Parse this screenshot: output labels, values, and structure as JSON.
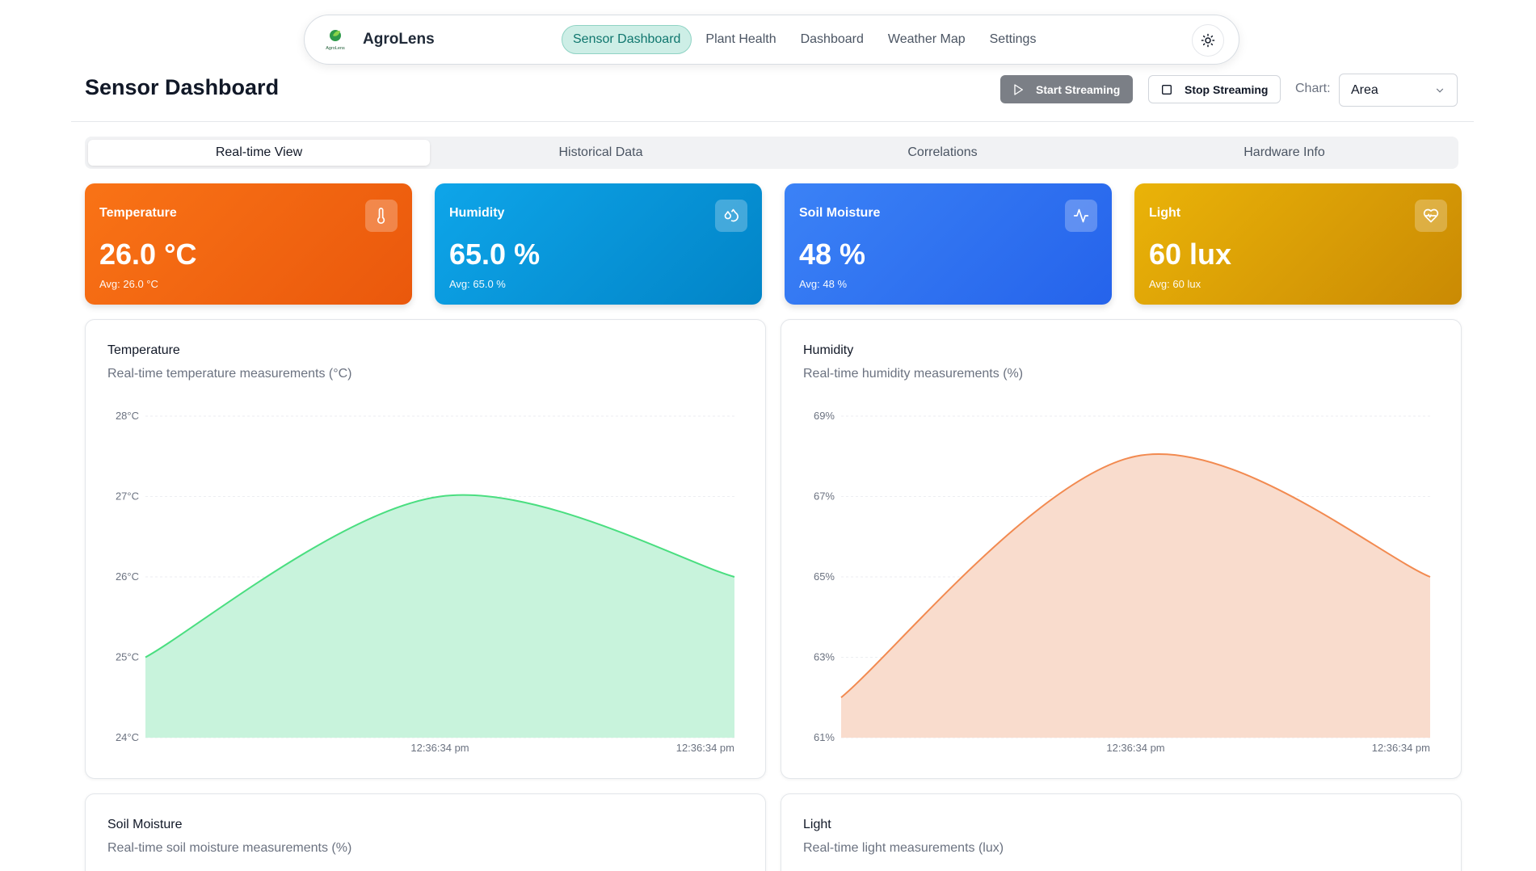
{
  "app": {
    "brand": "AgroLens",
    "logo_text": "AgroLens",
    "nav": [
      "Sensor Dashboard",
      "Plant Health",
      "Dashboard",
      "Weather Map",
      "Settings"
    ],
    "theme_icon": "sun-icon"
  },
  "header": {
    "title": "Sensor Dashboard",
    "start_label": "Start Streaming",
    "stop_label": "Stop Streaming",
    "chart_label": "Chart:",
    "chart_select_value": "Area"
  },
  "tabs": [
    "Real-time View",
    "Historical Data",
    "Correlations",
    "Hardware Info"
  ],
  "stats": [
    {
      "title": "Temperature",
      "value": "26.0 °C",
      "avg": "Avg: 26.0 °C",
      "icon": "thermometer-icon",
      "color": "#f97316"
    },
    {
      "title": "Humidity",
      "value": "65.0 %",
      "avg": "Avg: 65.0 %",
      "icon": "droplets-icon",
      "color": "#0ea5e9"
    },
    {
      "title": "Soil Moisture",
      "value": "48 %",
      "avg": "Avg: 48 %",
      "icon": "activity-icon",
      "color": "#3b82f6"
    },
    {
      "title": "Light",
      "value": "60 lux",
      "avg": "Avg: 60 lux",
      "icon": "heart-pulse-icon",
      "color": "#eab308"
    }
  ],
  "cards": {
    "temperature": {
      "title": "Temperature",
      "subtitle": "Real-time temperature measurements (°C)"
    },
    "humidity": {
      "title": "Humidity",
      "subtitle": "Real-time humidity measurements (%)"
    },
    "soil": {
      "title": "Soil Moisture",
      "subtitle": "Real-time soil moisture measurements (%)"
    },
    "light": {
      "title": "Light",
      "subtitle": "Real-time light measurements (lux)"
    }
  },
  "chart_data": [
    {
      "type": "area",
      "title": "Temperature",
      "x": [
        "",
        "12:36:34 pm",
        "12:36:34 pm"
      ],
      "x_tick_labels": [
        "12:36:34 pm",
        "12:36:34 pm"
      ],
      "values": [
        25.0,
        27.0,
        26.0
      ],
      "y_ticks": [
        24,
        25,
        26,
        27,
        28
      ],
      "y_tick_labels": [
        "24°C",
        "25°C",
        "26°C",
        "27°C",
        "28°C"
      ],
      "ylim": [
        24,
        28
      ],
      "stroke": "#4ade80",
      "fill": "#c8f3dc",
      "grid": true
    },
    {
      "type": "area",
      "title": "Humidity",
      "x": [
        "",
        "12:36:34 pm",
        "12:36:34 pm"
      ],
      "x_tick_labels": [
        "12:36:34 pm",
        "12:36:34 pm"
      ],
      "values": [
        62.0,
        68.0,
        65.0
      ],
      "y_ticks": [
        61,
        63,
        65,
        67,
        69
      ],
      "y_tick_labels": [
        "61%",
        "63%",
        "65%",
        "67%",
        "69%"
      ],
      "ylim": [
        61,
        69
      ],
      "stroke": "#f28a50",
      "fill": "#f9dccd",
      "grid": true
    }
  ]
}
